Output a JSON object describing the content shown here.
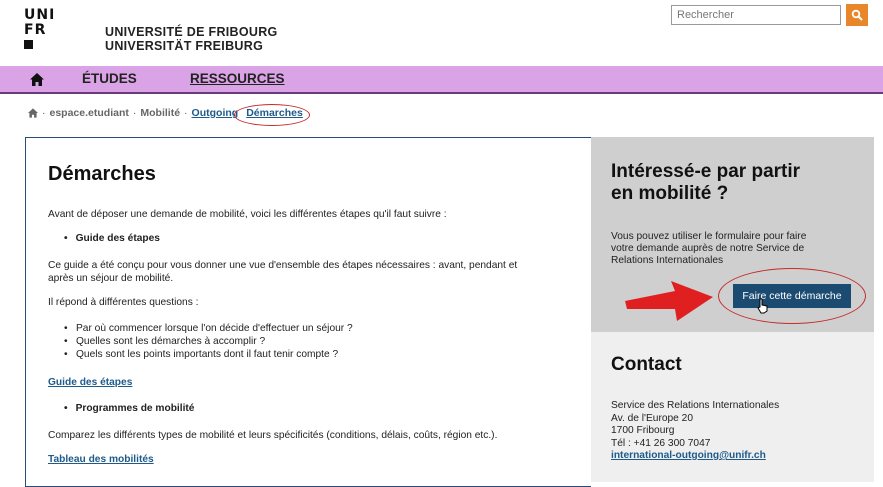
{
  "header": {
    "logo_lines": [
      "UNI",
      "FR"
    ],
    "university_fr": "UNIVERSITÉ DE FRIBOURG",
    "university_de": "UNIVERSITÄT FREIBURG",
    "search_placeholder": "Rechercher"
  },
  "nav": {
    "items": [
      {
        "label": "ÉTUDES",
        "active": false
      },
      {
        "label": "RESSOURCES",
        "active": true
      }
    ]
  },
  "breadcrumb": {
    "items": [
      "espace.etudiant",
      "Mobilité",
      "Outgoing",
      "Démarches"
    ],
    "separator": "·"
  },
  "main": {
    "title": "Démarches",
    "intro": "Avant de déposer une demande de mobilité, voici les différentes étapes qu'il faut suivre :",
    "guide_heading": "Guide des étapes",
    "guide_desc_line1": "Ce guide a été conçu pour vous donner une vue d'ensemble des étapes nécessaires : avant, pendant et",
    "guide_desc_line2": "après un séjour de mobilité.",
    "questions_intro": "Il répond à différentes questions :",
    "questions": [
      "Par où commencer lorsque l'on décide d'effectuer un séjour ?",
      "Quelles sont les démarches à accomplir ?",
      "Quels sont les points importants dont il faut tenir compte ?"
    ],
    "guide_link": "Guide des étapes",
    "programmes_heading": "Programmes de mobilité",
    "programmes_desc": "Comparez les différents types de mobilité et leurs spécificités (conditions, délais, coûts, région etc.).",
    "table_link": "Tableau des mobilités"
  },
  "sidebar": {
    "cta_title_line1": "Intéressé-e par partir",
    "cta_title_line2": "en mobilité ?",
    "cta_text_line1": "Vous pouvez utiliser le formulaire pour faire",
    "cta_text_line2": "votre demande auprès de notre Service de",
    "cta_text_line3": "Relations Internationales",
    "cta_button": "Faire cette démarche",
    "contact_title": "Contact",
    "contact_lines": [
      "Service des Relations Internationales",
      "Av. de l'Europe 20",
      "1700 Fribourg",
      "Tél : +41 26 300 7047"
    ],
    "contact_email": "international-outgoing@unifr.ch"
  },
  "colors": {
    "nav_bg": "#d9a3e6",
    "accent_blue": "#1c4b72",
    "link_blue": "#1e5a8a",
    "search_orange": "#e8862a",
    "annotation_red": "#c42b2b"
  }
}
